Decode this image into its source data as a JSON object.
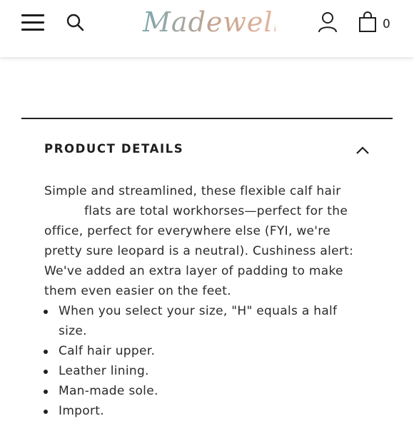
{
  "header": {
    "logo_text": "Madewell",
    "cart_count": "0",
    "icons": {
      "menu": "hamburger-menu-icon",
      "search": "search-icon",
      "account": "account-icon",
      "bag": "shopping-bag-icon"
    }
  },
  "section": {
    "title": "PRODUCT DETAILS",
    "toggle_icon": "chevron-up-icon",
    "description_line1": "Simple and streamlined, these flexible calf hair",
    "description_rest": "flats are total workhorses—perfect for the office, perfect for everywhere else (FYI, we're pretty sure leopard is a neutral). Cushiness alert: We've added an extra layer of padding to make them even easier on the feet.",
    "bullets": [
      "When you select your size, \"H\" equals a half size.",
      "Calf hair upper.",
      "Leather lining.",
      "Man-made sole.",
      "Import."
    ]
  },
  "colors": {
    "text": "#2a2a2a",
    "divider": "#222222",
    "logo_gradient": [
      "#7fa8b0",
      "#c9a48f",
      "#e8b7a0"
    ]
  }
}
